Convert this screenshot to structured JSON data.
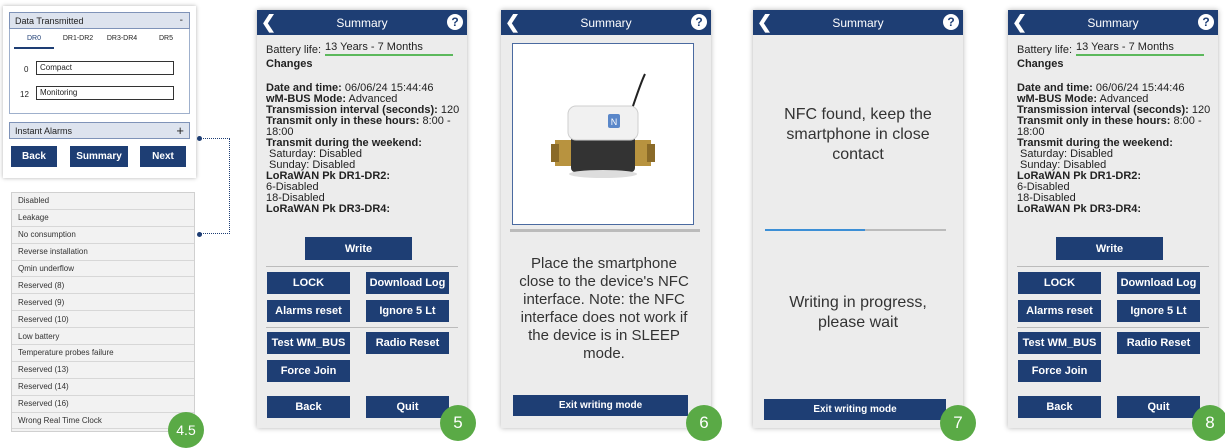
{
  "panel1": {
    "section_title": "Data Transmitted",
    "section_toggle": "-",
    "tabs": [
      "DR0",
      "DR1-DR2",
      "DR3-DR4",
      "DR5"
    ],
    "rows": [
      {
        "index": "0",
        "value": "Compact"
      },
      {
        "index": "12",
        "value": "Monitoring"
      }
    ],
    "alarms_title": "Instant Alarms",
    "alarms_toggle": "+",
    "back": "Back",
    "summary": "Summary",
    "next": "Next"
  },
  "alarm_list": {
    "items": [
      "Disabled",
      "Leakage",
      "No consumption",
      "Reverse installation",
      "Qmin underflow",
      "Reserved (8)",
      "Reserved (9)",
      "Reserved (10)",
      "Low battery",
      "Temperature probes failure",
      "Reserved (13)",
      "Reserved (14)",
      "Reserved (16)",
      "Wrong Real Time Clock"
    ],
    "badge": "4.5"
  },
  "summary": {
    "title": "Summary",
    "battery_label": "Battery life:",
    "battery_value": "13 Years - 7 Months",
    "changes": "Changes",
    "date_label": "Date and time:",
    "date_value": "06/06/24 15:44:46",
    "mode_label": "wM-BUS Mode:",
    "mode_value": "Advanced",
    "interval_label": "Transmission interval (seconds):",
    "interval_value": "120",
    "hours_label": "Transmit only in these hours:",
    "hours_value": "8:00 -",
    "hours_value2": "18:00",
    "weekend_label": "Transmit during the weekend:",
    "saturday": "Saturday:  Disabled",
    "sunday": "Sunday:  Disabled",
    "pk12_label": "LoRaWAN Pk DR1-DR2:",
    "pk12_a": "6-Disabled",
    "pk12_b": "18-Disabled",
    "pk34_label": "LoRaWAN Pk DR3-DR4:",
    "write": "Write",
    "lock": "LOCK",
    "download_log": "Download Log",
    "alarms_reset": "Alarms reset",
    "ignore": "Ignore 5 Lt",
    "test": "Test WM_BUS",
    "radio_reset": "Radio Reset",
    "force_join": "Force Join",
    "back": "Back",
    "quit": "Quit"
  },
  "nfc_place": {
    "title": "Summary",
    "device_label": "N",
    "message": "Place the smartphone close to the device's NFC interface. Note: the NFC interface does not work if the device is in SLEEP mode.",
    "exit": "Exit writing mode"
  },
  "nfc_write": {
    "title": "Summary",
    "found": "NFC found, keep the smartphone in close contact",
    "progress": 0.55,
    "writing": "Writing in progress, please wait",
    "exit": "Exit writing mode"
  },
  "badges": {
    "b5": "5",
    "b6": "6",
    "b7": "7",
    "b8": "8"
  },
  "colors": {
    "primary": "#1e3e74",
    "accent": "#5aaa46",
    "progress": "#3c8fd6"
  },
  "icons": [
    "back-arrow-icon",
    "help-icon",
    "nfc-icon"
  ]
}
